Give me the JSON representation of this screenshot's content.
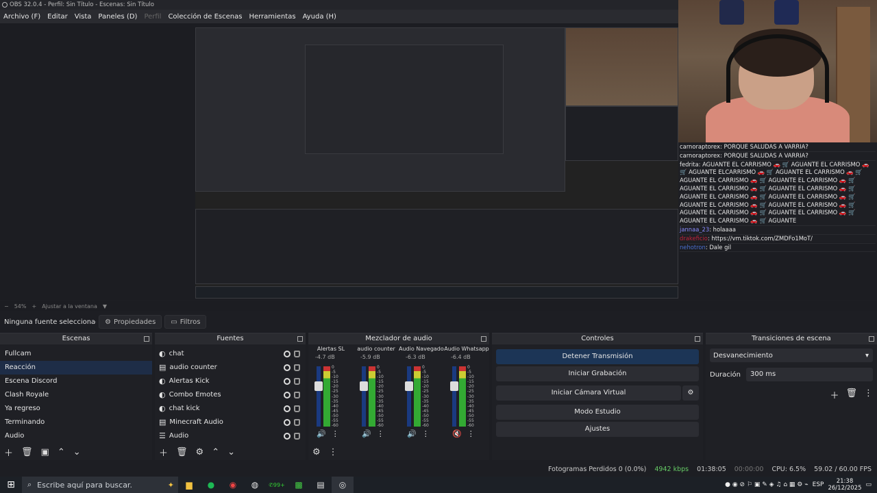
{
  "window": {
    "title": "OBS 32.0.4 - Perfil: Sin Título - Escenas: Sin Título"
  },
  "menu": [
    "Archivo (F)",
    "Editar",
    "Vista",
    "Paneles (D)",
    "Perfil",
    "Colección de Escenas",
    "Herramientas",
    "Ayuda (H)"
  ],
  "chat": [
    {
      "user": "carnoraptorex",
      "msg": ": PORQUE SALUDAS A VARRIA?",
      "color": "#e8e8e8"
    },
    {
      "user": "carnoraptorex",
      "msg": ": PORQUE SALUDAS A VARRIA?",
      "color": "#e8e8e8"
    },
    {
      "user": "fedrita",
      "msg": ": AGUANTE EL CARRISMO 🚗 🛒 AGUANTE EL CARRISMO 🚗 🛒 AGUANTE ELCARRISMO 🚗 🛒 AGUANTE EL CARRISMO 🚗 🛒 AGUANTE EL CARRISMO 🚗 🛒 AGUANTE EL CARRISMO 🚗 🛒 AGUANTE EL CARRISMO 🚗 🛒 AGUANTE EL CARRISMO 🚗 🛒 AGUANTE EL CARRISMO 🚗 🛒 AGUANTE EL CARRISMO 🚗 🛒 AGUANTE EL CARRISMO 🚗 🛒 AGUANTE EL CARRISMO 🚗 🛒 AGUANTE EL CARRISMO 🚗 🛒 AGUANTE EL CARRISMO 🚗 🛒 AGUANTE EL CARRISMO 🚗 🛒 AGUANTE",
      "color": "#e8e8e8"
    },
    {
      "user": "jannaa_23",
      "msg": ": holaaaa",
      "color": "#8a8cff"
    },
    {
      "user": "drakeficio",
      "msg": ": https://vm.tiktok.com/ZMDFo1MoT/",
      "color": "#c0233a"
    },
    {
      "user": "nehotron",
      "msg": ": Dale gil",
      "color": "#4a6fd0"
    }
  ],
  "zoom": {
    "percent": "54%",
    "fit": "Ajustar a la ventana"
  },
  "source_bar": {
    "no_selection": "Ninguna fuente seleccionada",
    "properties": "Propiedades",
    "filters": "Filtros"
  },
  "scenes": {
    "title": "Escenas",
    "items": [
      "Fullcam",
      "Reacción",
      "Escena Discord",
      "Clash Royale",
      "Ya regreso",
      "Terminando",
      "Audio"
    ],
    "selected": 1
  },
  "sources": {
    "title": "Fuentes",
    "items": [
      "chat",
      "audio counter",
      "Alertas Kick",
      "Combo Emotes",
      "chat kick",
      "Minecraft Audio",
      "Audio"
    ]
  },
  "mixer": {
    "title": "Mezclador de audio",
    "scale": [
      "0",
      "-5",
      "-10",
      "-15",
      "-20",
      "-25",
      "-30",
      "-35",
      "-40",
      "-45",
      "-50",
      "-55",
      "-60"
    ],
    "channels": [
      {
        "name": "Alertas SL",
        "db": "-4.7 dB",
        "fader": 0.75,
        "muted": false
      },
      {
        "name": "audio counter",
        "db": "-5.9 dB",
        "fader": 0.75,
        "muted": false
      },
      {
        "name": "Audio Navegador",
        "db": "-6.3 dB",
        "fader": 0.75,
        "muted": false
      },
      {
        "name": "Audio Whatsapp",
        "db": "-6.4 dB",
        "fader": 0.75,
        "muted": true
      }
    ]
  },
  "controls": {
    "title": "Controles",
    "stop_stream": "Detener Transmisión",
    "start_record": "Iniciar Grabación",
    "virtual_cam": "Iniciar Cámara Virtual",
    "studio": "Modo Estudio",
    "settings": "Ajustes"
  },
  "transitions": {
    "title": "Transiciones de escena",
    "selected": "Desvanecimiento",
    "duration_label": "Duración",
    "duration": "300 ms"
  },
  "status": {
    "dropped": "Fotogramas Perdidos 0 (0.0%)",
    "bitrate": "4942 kbps",
    "stream_time": "01:38:05",
    "rec_time": "00:00:00",
    "cpu": "CPU: 6.5%",
    "fps": "59.02 / 60.00 FPS"
  },
  "taskbar": {
    "search": "Escribe aquí para buscar.",
    "lang": "ESP",
    "time": "21:38",
    "date": "26/12/2025",
    "badge": "99+"
  }
}
